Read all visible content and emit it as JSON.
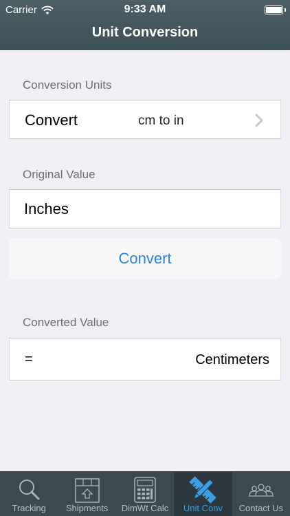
{
  "status_bar": {
    "carrier": "Carrier",
    "time": "9:33 AM"
  },
  "nav": {
    "title": "Unit Conversion"
  },
  "conversion_units": {
    "section_label": "Conversion Units",
    "row_label": "Convert",
    "selected_value": "cm to in"
  },
  "original_value": {
    "section_label": "Original Value",
    "placeholder": "Inches"
  },
  "convert_button": {
    "label": "Convert"
  },
  "converted_value": {
    "section_label": "Converted Value",
    "equals": "=",
    "unit": "Centimeters"
  },
  "tab_bar": {
    "tabs": [
      {
        "label": "Tracking",
        "icon": "magnifier-icon"
      },
      {
        "label": "Shipments",
        "icon": "box-icon"
      },
      {
        "label": "DimWt Calc",
        "icon": "calculator-icon"
      },
      {
        "label": "Unit Conv",
        "icon": "pencil-ruler-icon",
        "selected": true
      },
      {
        "label": "Contact Us",
        "icon": "people-icon"
      }
    ]
  },
  "colors": {
    "header": "#435559",
    "accent": "#2f86d9",
    "tab_selected": "#3aa0e3",
    "background": "#efeff4"
  }
}
